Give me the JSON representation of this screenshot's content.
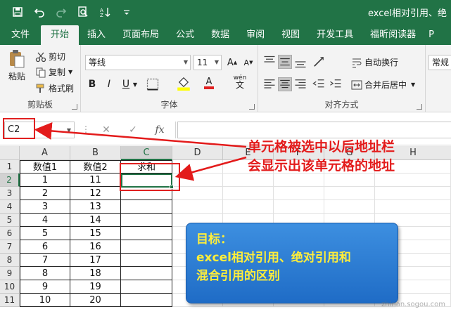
{
  "window": {
    "title": "excel相对引用、绝"
  },
  "quick_access": {
    "icons": [
      "save-icon",
      "undo-icon",
      "redo-icon",
      "print-preview-icon",
      "sort-icon",
      "customize-icon"
    ]
  },
  "tabs": [
    "文件",
    "开始",
    "插入",
    "页面布局",
    "公式",
    "数据",
    "审阅",
    "视图",
    "开发工具",
    "福昕阅读器",
    "P"
  ],
  "ribbon": {
    "clipboard": {
      "paste": "粘贴",
      "cut": "剪切",
      "copy": "复制",
      "format_painter": "格式刷",
      "label": "剪贴板"
    },
    "font": {
      "name": "等线",
      "size": "11",
      "label": "字体",
      "bold": "B",
      "italic": "I",
      "underline": "U",
      "wen": "wén",
      "wen_char": "文"
    },
    "alignment": {
      "wrap": "自动换行",
      "merge": "合并后居中",
      "label": "对齐方式"
    },
    "number": {
      "format": "常规"
    }
  },
  "formula_bar": {
    "name_box": "C2",
    "fx": "fx",
    "cancel": "✕",
    "confirm": "✓"
  },
  "sheet": {
    "columns": [
      "A",
      "B",
      "C",
      "D",
      "E",
      "F",
      "G",
      "H"
    ],
    "rows": [
      "1",
      "2",
      "3",
      "4",
      "5",
      "6",
      "7",
      "8",
      "9",
      "10",
      "11"
    ],
    "header": [
      "数值1",
      "数值2",
      "求和"
    ],
    "data": [
      [
        "1",
        "11"
      ],
      [
        "2",
        "12"
      ],
      [
        "3",
        "13"
      ],
      [
        "4",
        "14"
      ],
      [
        "5",
        "15"
      ],
      [
        "6",
        "16"
      ],
      [
        "7",
        "17"
      ],
      [
        "8",
        "18"
      ],
      [
        "9",
        "19"
      ],
      [
        "10",
        "20"
      ]
    ],
    "selected_cell": "C2"
  },
  "annotation": {
    "line1": "单元格被选中以后地址栏",
    "line2": "会显示出该单元格的地址"
  },
  "callout": {
    "line1": "目标：",
    "line2": "excel相对引用、绝对引用和",
    "line3": "混合引用的区别"
  },
  "watermark": "zhinan.sogou.com",
  "colors": {
    "accent": "#217346",
    "annotation": "#e31b1b",
    "callout_bg": "#2a7bd4",
    "callout_text": "#ffee3a"
  }
}
